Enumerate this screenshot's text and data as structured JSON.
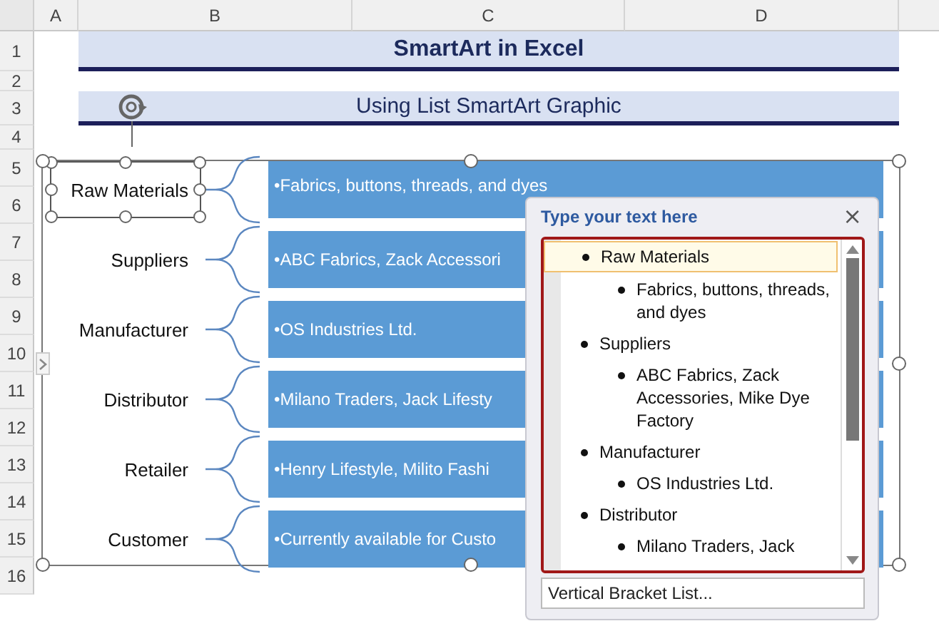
{
  "sheet": {
    "columns": [
      "A",
      "B",
      "C",
      "D"
    ],
    "rows": [
      "1",
      "2",
      "3",
      "4",
      "5",
      "6",
      "7",
      "8",
      "9",
      "10",
      "11",
      "12",
      "13",
      "14",
      "15",
      "16"
    ],
    "title": "SmartArt in Excel",
    "subtitle": "Using List SmartArt Graphic"
  },
  "smartart": {
    "items": [
      {
        "label": "Raw Materials",
        "text": "•Fabrics, buttons, threads, and dyes",
        "selected": true
      },
      {
        "label": "Suppliers",
        "text": "•ABC Fabrics, Zack Accessori",
        "selected": false
      },
      {
        "label": "Manufacturer",
        "text": "•OS Industries Ltd.",
        "selected": false
      },
      {
        "label": "Distributor",
        "text": "•Milano Traders, Jack Lifesty",
        "selected": false
      },
      {
        "label": "Retailer",
        "text": "•Henry Lifestyle, Milito Fashi",
        "selected": false
      },
      {
        "label": "Customer",
        "text": "•Currently available for Custo",
        "selected": false
      }
    ]
  },
  "text_pane": {
    "title": "Type your text here",
    "close": "×",
    "items": [
      {
        "text": "Raw Materials",
        "selected": true,
        "children": [
          {
            "text": "Fabrics, buttons, threads, and dyes"
          }
        ]
      },
      {
        "text": "Suppliers",
        "selected": false,
        "children": [
          {
            "text": "ABC Fabrics, Zack Accessories, Mike Dye Factory"
          }
        ]
      },
      {
        "text": "Manufacturer",
        "selected": false,
        "children": [
          {
            "text": "OS Industries Ltd."
          }
        ]
      },
      {
        "text": "Distributor",
        "selected": false,
        "children": [
          {
            "text": "Milano Traders, Jack"
          }
        ]
      }
    ],
    "footer": "Vertical Bracket List..."
  }
}
